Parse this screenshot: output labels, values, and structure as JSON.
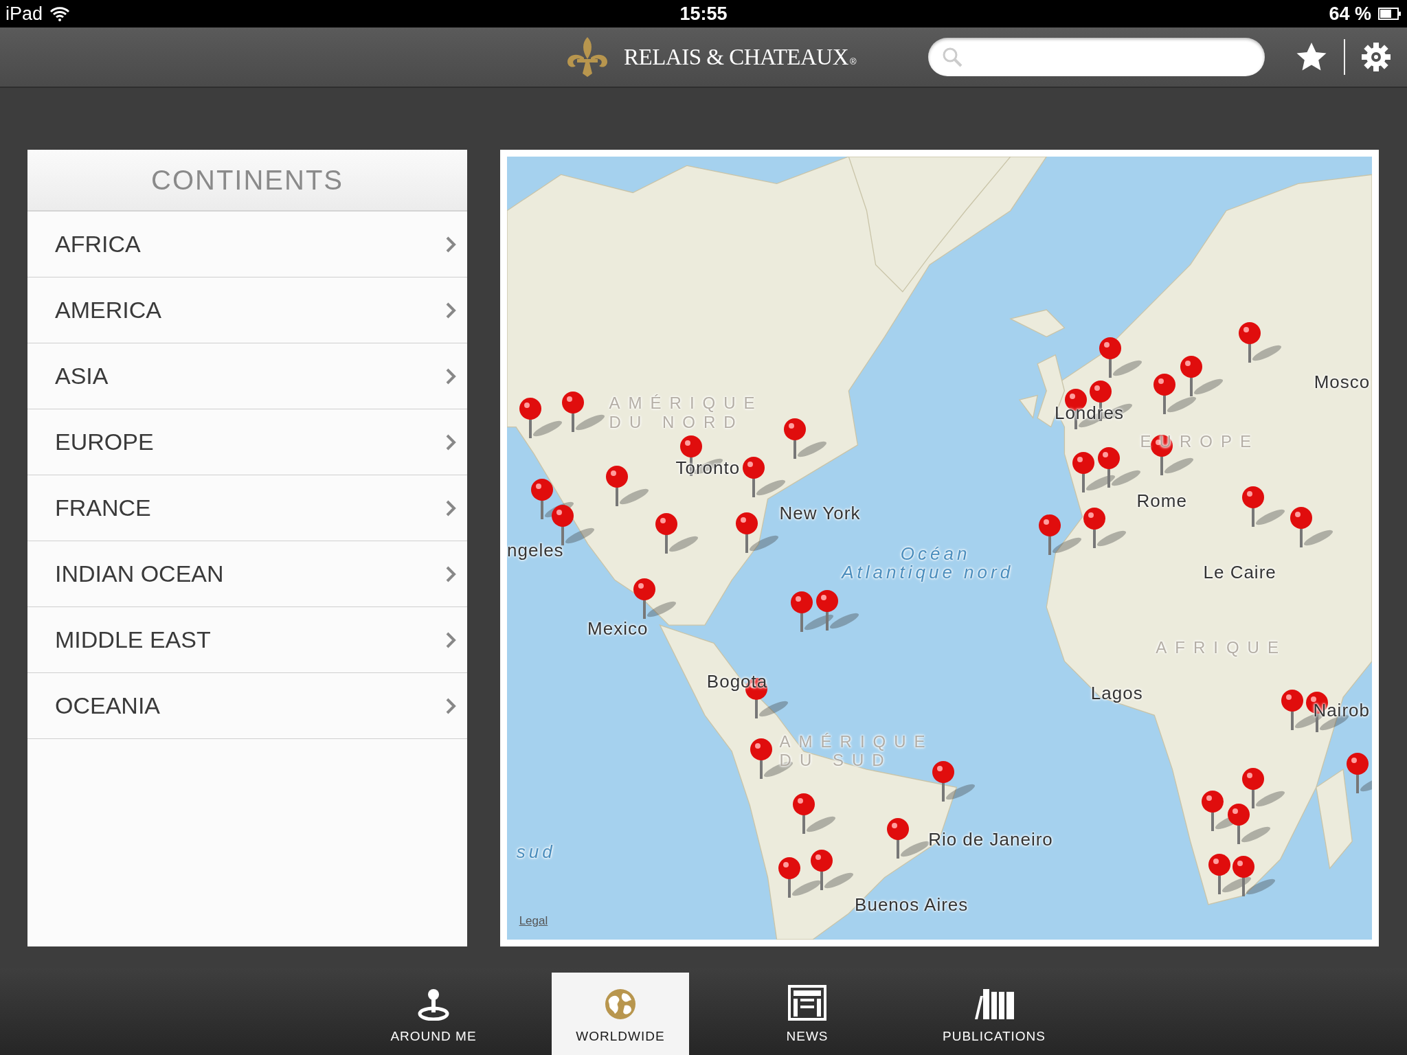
{
  "status_bar": {
    "device": "iPad",
    "time": "15:55",
    "battery": "64 %"
  },
  "header": {
    "brand": "RELAIS & CHATEAUX",
    "brand_mark": "®"
  },
  "continents": {
    "title": "CONTINENTS",
    "items": [
      {
        "label": "AFRICA"
      },
      {
        "label": "AMERICA"
      },
      {
        "label": "ASIA"
      },
      {
        "label": "EUROPE"
      },
      {
        "label": "FRANCE"
      },
      {
        "label": "INDIAN OCEAN"
      },
      {
        "label": "MIDDLE EAST"
      },
      {
        "label": "OCEANIA"
      }
    ]
  },
  "map": {
    "labels": [
      {
        "text": "AMÉRIQUE DU NORD",
        "kind": "region"
      },
      {
        "text": "Mosco",
        "kind": "city"
      },
      {
        "text": "Londres",
        "kind": "city"
      },
      {
        "text": "EUROPE",
        "kind": "region"
      },
      {
        "text": "Toronto",
        "kind": "city"
      },
      {
        "text": "New York",
        "kind": "city"
      },
      {
        "text": "Rome",
        "kind": "city"
      },
      {
        "text": "ngeles",
        "kind": "city"
      },
      {
        "text": "Océan",
        "kind": "ocean"
      },
      {
        "text": "Atlantique nord",
        "kind": "ocean"
      },
      {
        "text": "Le Caire",
        "kind": "city"
      },
      {
        "text": "Mexico",
        "kind": "city"
      },
      {
        "text": "AFRIQUE",
        "kind": "region"
      },
      {
        "text": "Bogota",
        "kind": "city"
      },
      {
        "text": "Lagos",
        "kind": "city"
      },
      {
        "text": "Nairob",
        "kind": "city"
      },
      {
        "text": "AMÉRIQUE DU SUD",
        "kind": "region"
      },
      {
        "text": "Rio de Janeiro",
        "kind": "city"
      },
      {
        "text": "sud",
        "kind": "ocean"
      },
      {
        "text": "Buenos Aires",
        "kind": "city"
      }
    ],
    "legal": "Legal"
  },
  "tabs": [
    {
      "label": "AROUND ME",
      "selected": false
    },
    {
      "label": "WORLDWIDE",
      "selected": true
    },
    {
      "label": "NEWS",
      "selected": false
    },
    {
      "label": "PUBLICATIONS",
      "selected": false
    }
  ]
}
